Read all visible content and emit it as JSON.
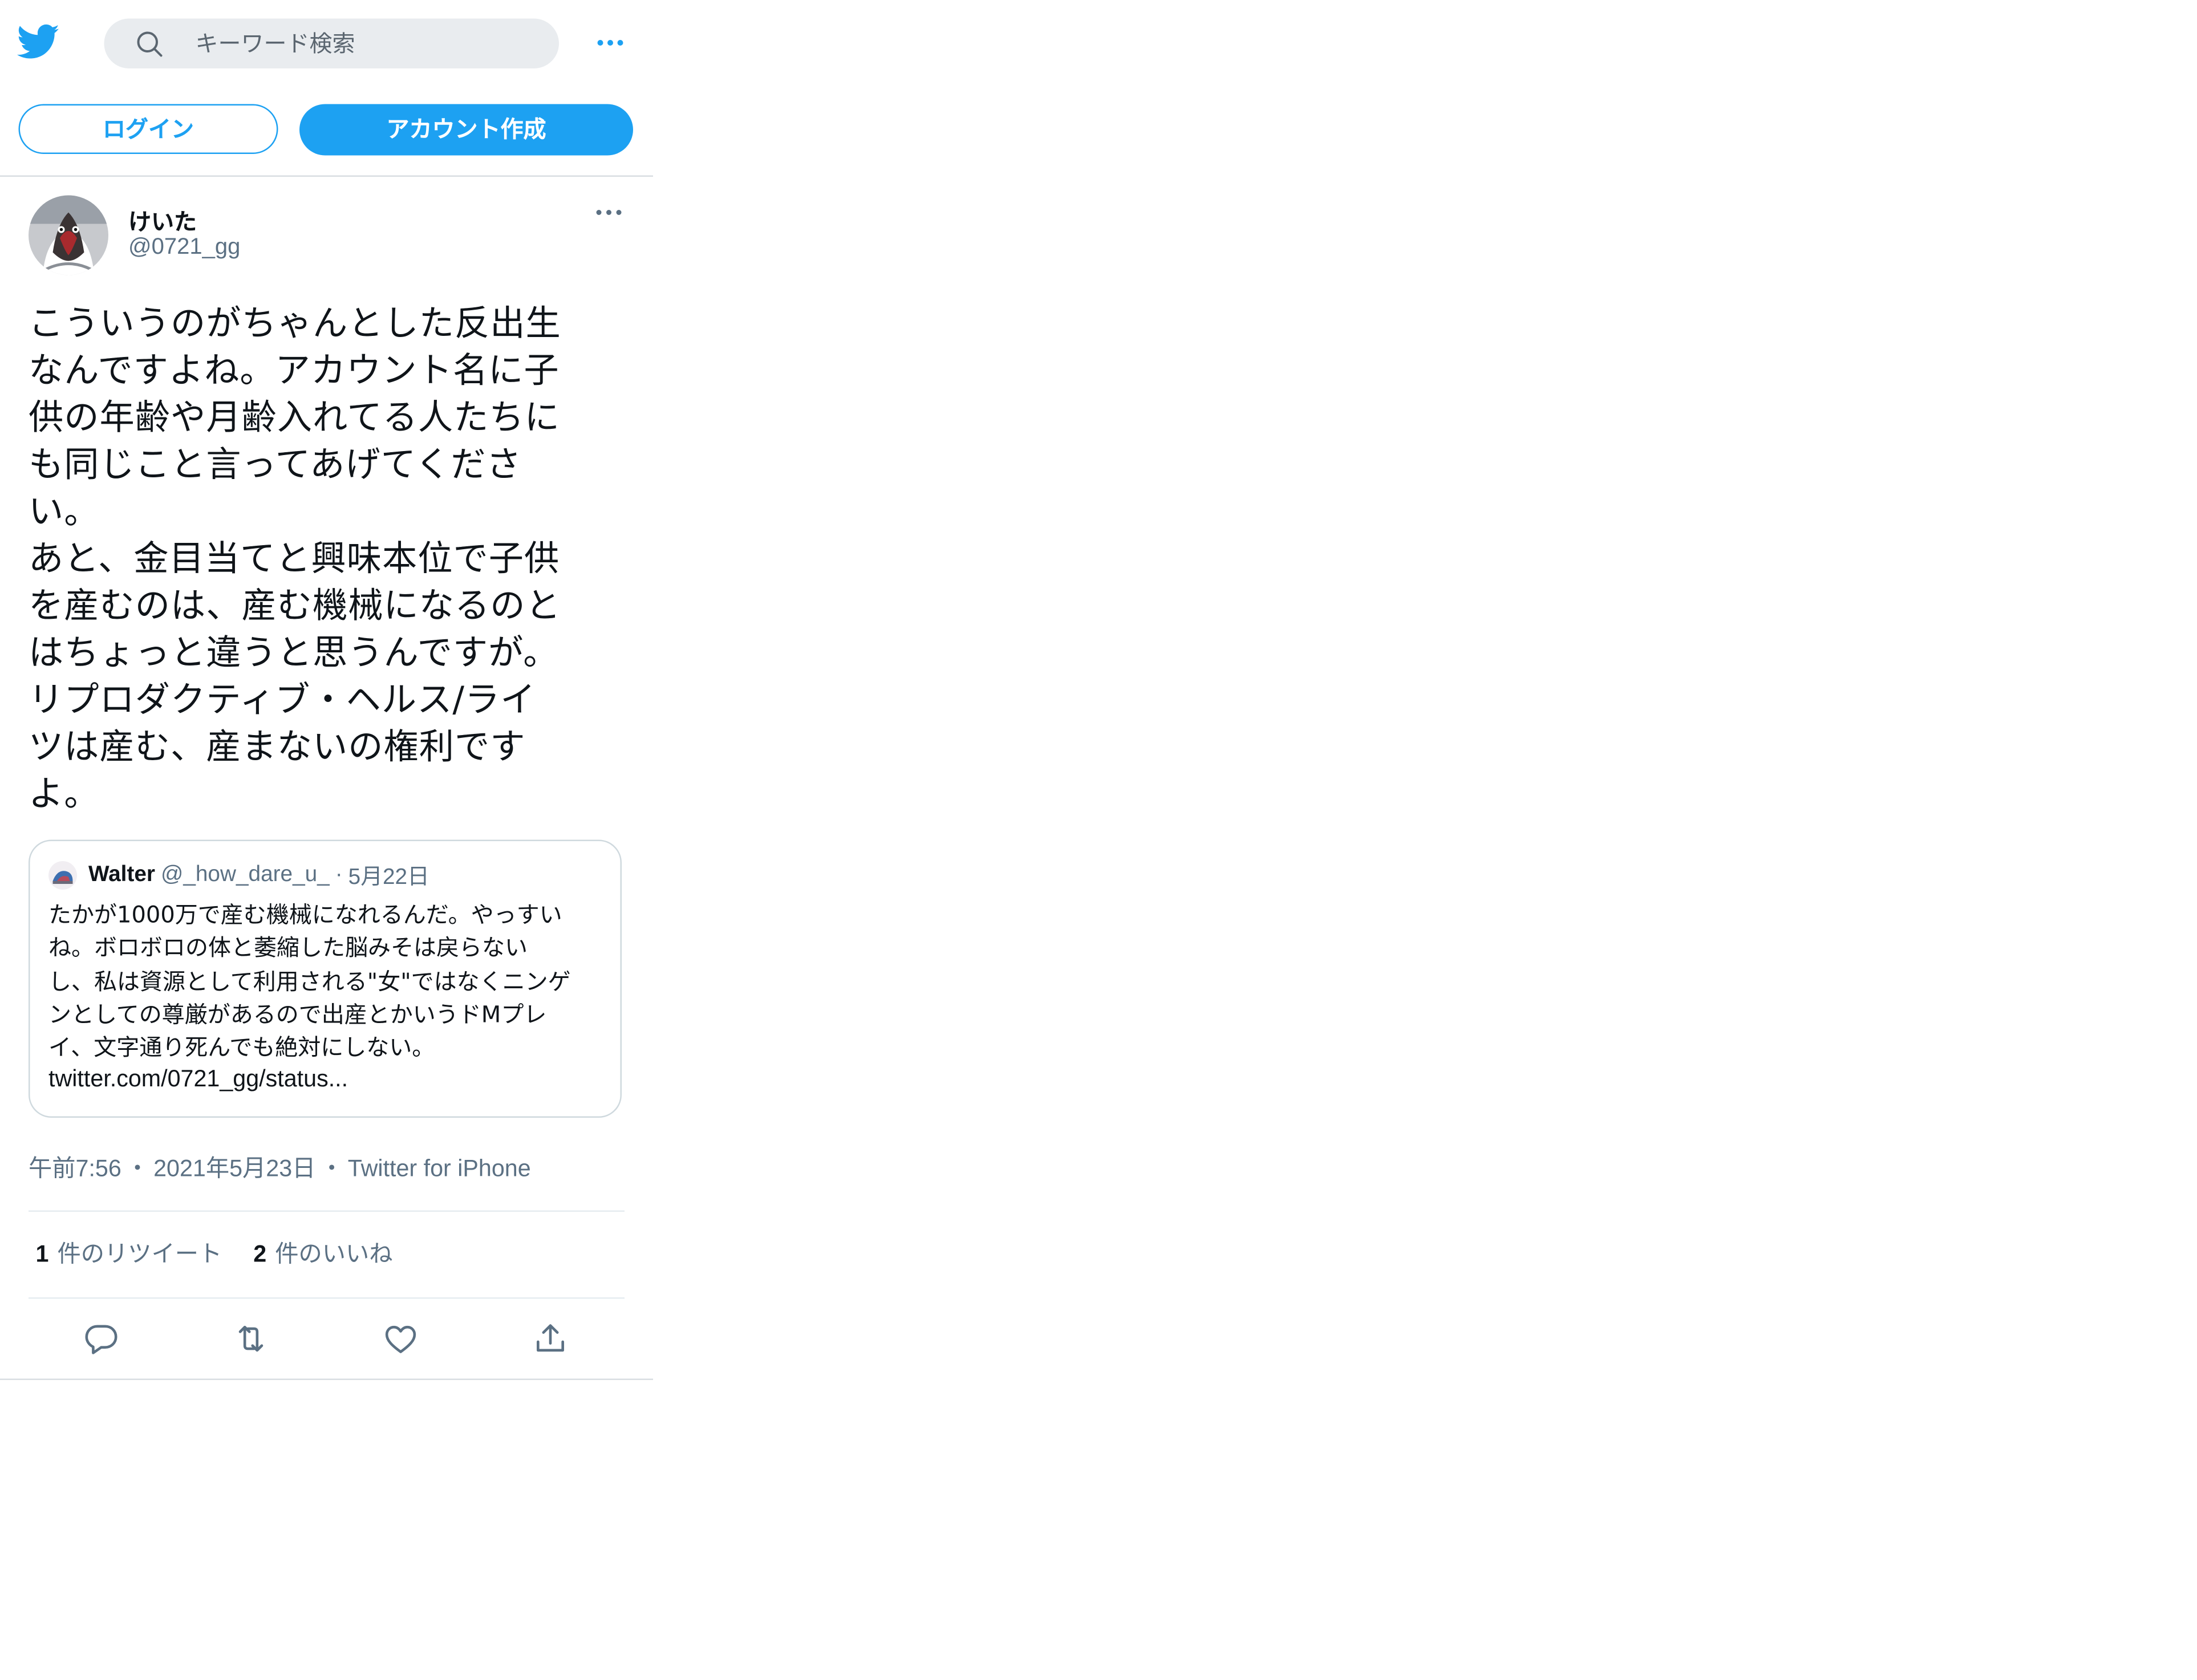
{
  "header": {
    "logo_icon": "twitter-bird-icon",
    "search_icon": "search-icon",
    "search_placeholder": "キーワード検索",
    "more_icon": "more-horizontal-icon"
  },
  "auth": {
    "login_label": "ログイン",
    "signup_label": "アカウント作成"
  },
  "colors": {
    "brand": "#1da1f2",
    "text": "#0f1419",
    "secondary": "#5b7083",
    "border": "#cfd9de"
  },
  "tweet": {
    "display_name": "けいた",
    "handle": "@0721_gg",
    "text": "こういうのがちゃんとした反出生\nなんですよね。アカウント名に子\n供の年齢や月齢入れてる人たちに\nも同じこと言ってあげてくださ\nい。\nあと、金目当てと興味本位で子供\nを産むのは、産む機械になるのと\nはちょっと違うと思うんですが。\nリプロダクティブ・ヘルス/ライ\nツは産む、産まないの権利です\nよ。",
    "quote": {
      "name": "Walter",
      "handle": "@_how_dare_u_",
      "separator": "·",
      "date": "5月22日",
      "text": "たかが1000万で産む機械になれるんだ。やっすい\nね。ボロボロの体と萎縮した脳みそは戻らない\nし、私は資源として利用される\"女\"ではなくニンゲ\nンとしての尊厳があるので出産とかいうドMプレ\nイ、文字通り死んでも絶対にしない。",
      "link": "twitter.com/0721_gg/status..."
    },
    "time": "午前7:56",
    "dot": "・",
    "date": "2021年5月23日",
    "source": "Twitter for iPhone",
    "retweets_count": "1",
    "retweets_label": "件のリツイート",
    "likes_count": "2",
    "likes_label": "件のいいね",
    "actions": [
      "reply-icon",
      "retweet-icon",
      "like-icon",
      "share-icon"
    ]
  }
}
